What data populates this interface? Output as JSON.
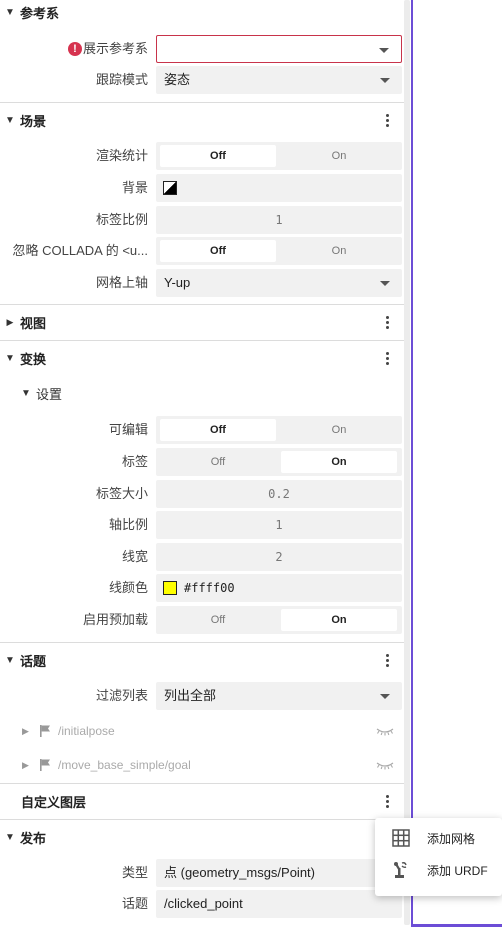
{
  "sections": {
    "frame": {
      "title": "参考系"
    },
    "scene": {
      "title": "场景"
    },
    "view": {
      "title": "视图"
    },
    "transforms": {
      "title": "变换",
      "settings_title": "设置"
    },
    "topics": {
      "title": "话题"
    },
    "custom_layers": {
      "title": "自定义图层"
    },
    "publish": {
      "title": "发布"
    }
  },
  "frame": {
    "display_frame_label": "展示参考系",
    "display_frame_value": "",
    "follow_mode_label": "跟踪模式",
    "follow_mode_value": "姿态"
  },
  "scene": {
    "render_stats_label": "渲染统计",
    "render_stats_value": "Off",
    "background_label": "背景",
    "label_scale_label": "标签比例",
    "label_scale_value": "1",
    "ignore_collada_label": "忽略 COLLADA 的 <u...",
    "ignore_collada_value": "Off",
    "mesh_up_axis_label": "网格上轴",
    "mesh_up_axis_value": "Y-up"
  },
  "toggle": {
    "off": "Off",
    "on": "On"
  },
  "transforms": {
    "editable_label": "可编辑",
    "editable_value": "Off",
    "labels_label": "标签",
    "labels_value": "On",
    "label_size_label": "标签大小",
    "label_size_value": "0.2",
    "axis_scale_label": "轴比例",
    "axis_scale_value": "1",
    "line_width_label": "线宽",
    "line_width_value": "2",
    "line_color_label": "线颜色",
    "line_color_value": "#ffff00",
    "preload_label": "启用预加载",
    "preload_value": "On"
  },
  "topics": {
    "filter_label": "过滤列表",
    "filter_value": "列出全部",
    "items": [
      {
        "name": "/initialpose"
      },
      {
        "name": "/move_base_simple/goal"
      }
    ]
  },
  "publish": {
    "type_label": "类型",
    "type_value": "点 (geometry_msgs/Point)",
    "topic_label": "话题",
    "topic_value": "/clicked_point"
  },
  "menu": {
    "add_grid": "添加网格",
    "add_urdf": "添加 URDF"
  },
  "colors": {
    "error": "#d6334f",
    "accent_border": "#6c4dd6",
    "line_color": "#ffff00"
  }
}
